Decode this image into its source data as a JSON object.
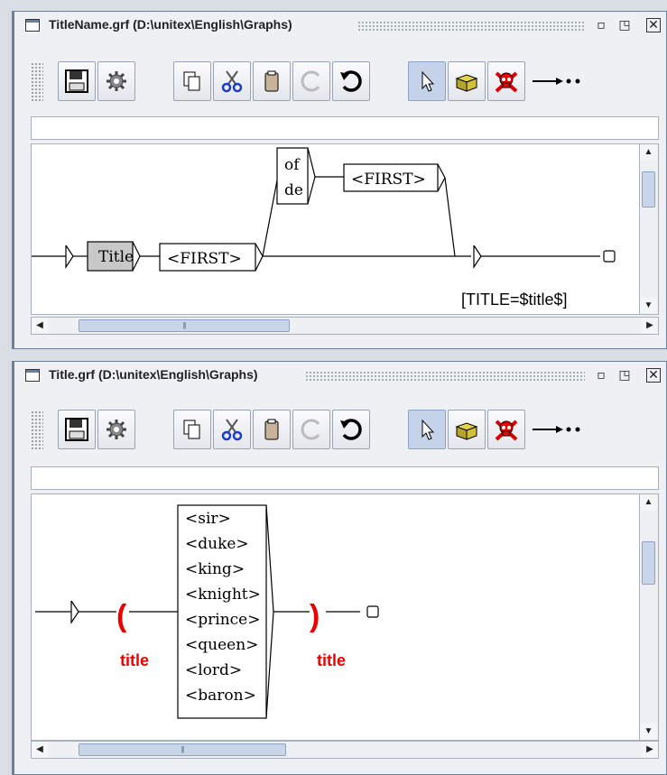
{
  "window1": {
    "title": "TitleName.grf (D:\\unitex\\English\\Graphs)",
    "nodes": {
      "title_box": "Title",
      "first1": "<FIRST>",
      "of": "of",
      "de": "de",
      "first2": "<FIRST>"
    },
    "output": "[TITLE=$title$]"
  },
  "window2": {
    "title": "Title.grf (D:\\unitex\\English\\Graphs)",
    "nodes": {
      "open_paren": "(",
      "close_paren": ")",
      "var_left": "title",
      "var_right": "title",
      "list": [
        "<sir>",
        "<duke>",
        "<king>",
        "<knight>",
        "<prince>",
        "<queen>",
        "<lord>",
        "<baron>"
      ]
    }
  },
  "icons": [
    "save-icon",
    "compile-icon",
    "copy-icon",
    "cut-icon",
    "paste-icon",
    "redo-icon",
    "undo-icon",
    "pointer-icon",
    "box-icon",
    "skull-icon",
    "arrow-icon"
  ],
  "colors": {
    "variable": "#e00000",
    "selected_button": "#c4d3ea",
    "window_border": "#6d7f99"
  }
}
